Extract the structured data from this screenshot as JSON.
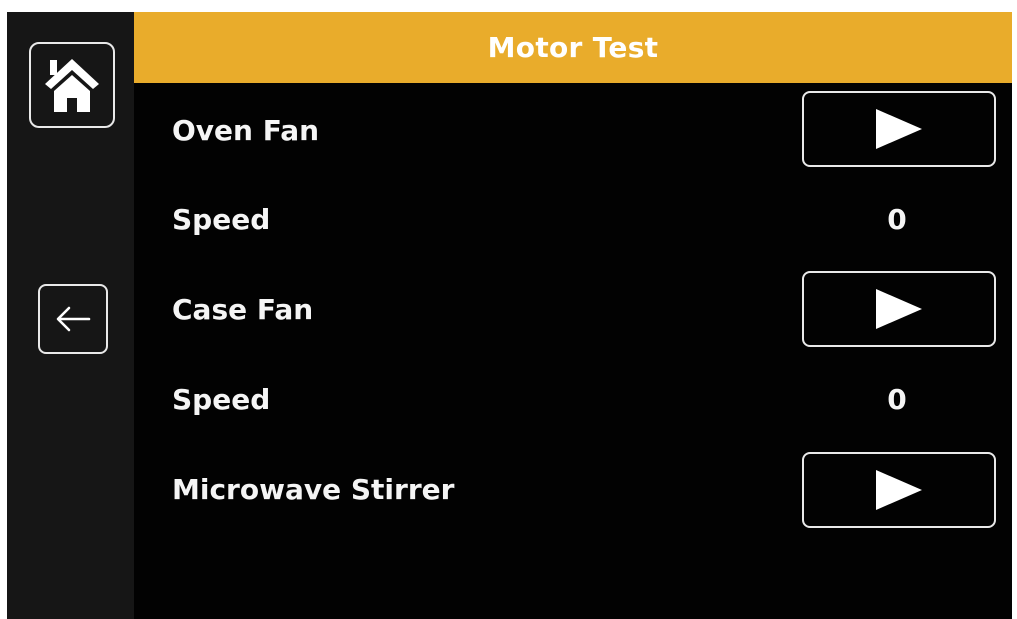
{
  "header": {
    "title": "Motor Test"
  },
  "side_nav": {
    "home_icon": "home-icon",
    "back_icon": "arrow-left-icon"
  },
  "rows": [
    {
      "label": "Oven Fan",
      "control": "play-button",
      "icon": "play-icon"
    },
    {
      "label": "Speed",
      "value": "0"
    },
    {
      "label": "Case Fan",
      "control": "play-button",
      "icon": "play-icon"
    },
    {
      "label": "Speed",
      "value": "0"
    },
    {
      "label": "Microwave Stirrer",
      "control": "play-button",
      "icon": "play-icon"
    }
  ],
  "colors": {
    "header_bg": "#e9ac2b",
    "screen_bg": "#020202",
    "side_rail_bg": "#161616",
    "text": "#f5f5f5",
    "bezel": "#ffffff"
  }
}
